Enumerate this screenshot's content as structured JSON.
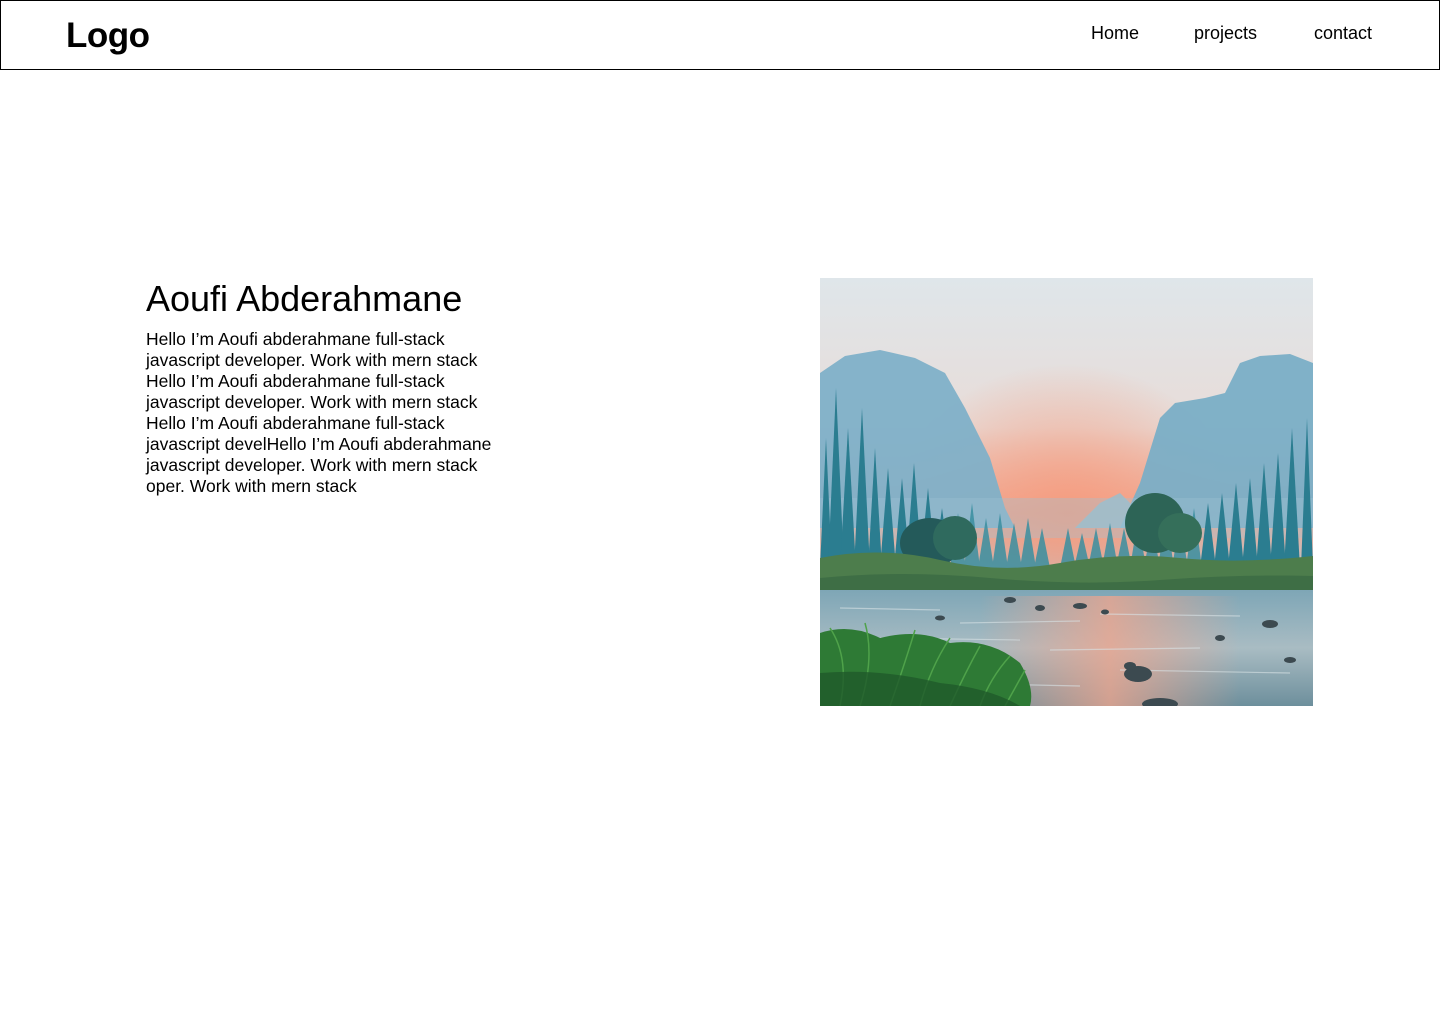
{
  "header": {
    "logo": "Logo",
    "nav": {
      "home": "Home",
      "projects": "projects",
      "contact": "contact"
    }
  },
  "hero": {
    "title": "Aoufi Abderahmane",
    "text": "Hello I’m Aoufi abderahmane full-stack javascript developer. Work with mern stack Hello I’m Aoufi abderahmane full-stack javascript developer. Work with mern stack Hello I’m Aoufi abderahmane full-stack javascript develHello I’m Aoufi abderahmane javascript developer. Work with mern stack oper. Work with mern stack",
    "image": {
      "icon": "landscape-photo",
      "palette": {
        "sky_top": "#e3e8ec",
        "sunset": "#f3a58c",
        "mountain": "#6fa6c1",
        "forest": "#2f7f92",
        "grass": "#3f8a3a",
        "water": "#8fb0bd"
      }
    }
  }
}
